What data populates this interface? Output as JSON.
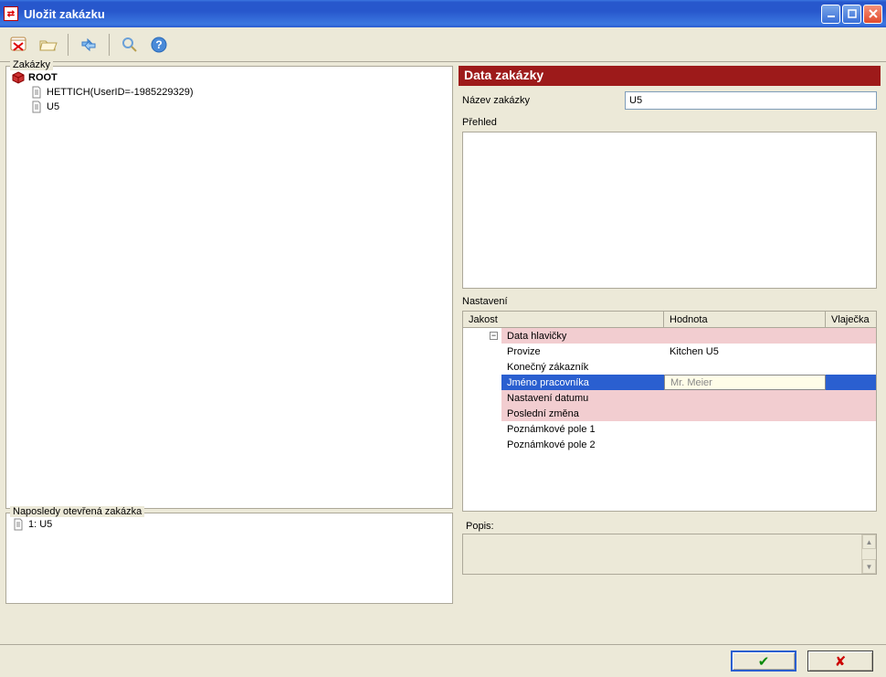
{
  "window": {
    "title": "Uložit zakázku"
  },
  "left": {
    "tree_label": "Zakázky",
    "root": "ROOT",
    "child1": "HETTICH(UserID=-1985229329)",
    "child2": "U5",
    "recent_label": "Naposledy otevřená zakázka",
    "recent_item": "1:  U5"
  },
  "right": {
    "header": "Data zakázky",
    "name_label": "Název zakázky",
    "name_value": "U5",
    "preview_label": "Přehled",
    "settings_label": "Nastavení",
    "col_quality": "Jakost",
    "col_value": "Hodnota",
    "col_flag": "Vlaječka",
    "rows": {
      "group": "Data hlavičky",
      "r1q": "Provize",
      "r1v": "Kitchen U5",
      "r2q": "Konečný zákazník",
      "r3q": "Jméno pracovníka",
      "r3v": "Mr. Meier",
      "r4q": "Nastavení datumu",
      "r5q": "Poslední změna",
      "r6q": "Poznámkové pole 1",
      "r7q": "Poznámkové pole 2"
    },
    "popis_label": "Popis:"
  }
}
